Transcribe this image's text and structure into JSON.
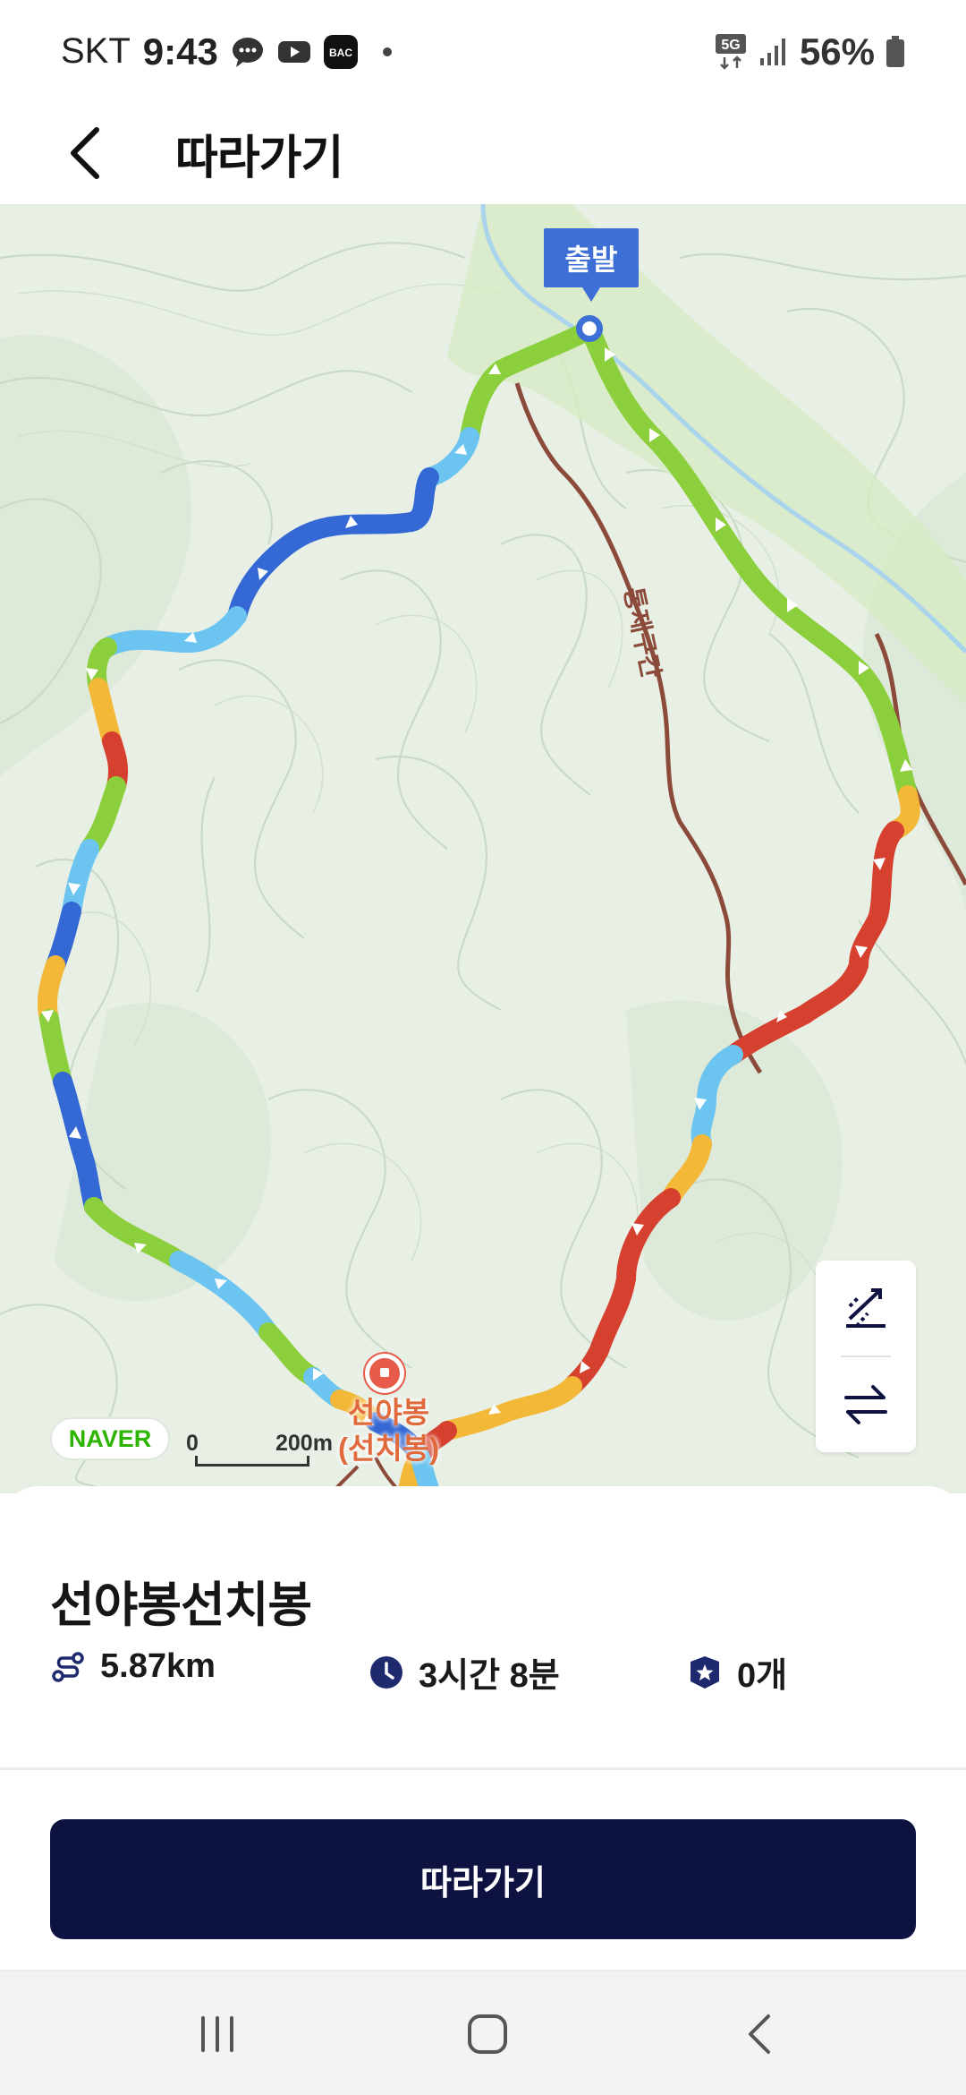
{
  "status_bar": {
    "carrier": "SKT",
    "time": "9:43",
    "notification_icons": [
      "chat-bubble-icon",
      "youtube-icon",
      "bac-app-icon"
    ],
    "bac_label": "BAC",
    "network": "5G",
    "battery": "56%"
  },
  "header": {
    "back_icon": "chevron-left-icon",
    "title": "따라가기"
  },
  "map": {
    "start_label": "출발",
    "restricted_label": "통제구간",
    "peak_name_line1": "선야봉",
    "peak_name_line2": "(선치봉)",
    "provider": "NAVER",
    "scale_start": "0",
    "scale_end": "200m",
    "controls": [
      "elevation-toggle-icon",
      "reverse-route-icon"
    ],
    "colors": {
      "green": "#8ccf3c",
      "light_blue": "#6cc4f0",
      "blue": "#3468d4",
      "yellow": "#f3b838",
      "red": "#d6402e",
      "restricted_path": "#8b4a3a",
      "start_marker": "#3d6fd6"
    }
  },
  "route": {
    "name": "선야봉선치봉",
    "distance": "5.87km",
    "duration": "3시간 8분",
    "count": "0개"
  },
  "follow_button_label": "따라가기",
  "nav_bar": [
    "recent-apps-icon",
    "home-icon",
    "back-icon"
  ]
}
